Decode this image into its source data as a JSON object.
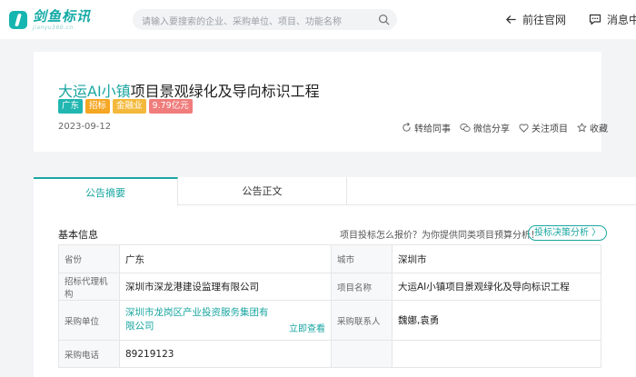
{
  "header": {
    "logo_cn": "剑鱼标讯",
    "logo_en": "jianyu360.cn",
    "search_placeholder": "请输入要搜索的企业、采购单位、项目、功能名称",
    "home_link": "前往官网",
    "msg_link": "消息中"
  },
  "project": {
    "title_highlight": "大运AI小镇",
    "title_rest": "项目景观绿化及导向标识工程",
    "tags": [
      "广东",
      "招标",
      "金融业",
      "9.79亿元"
    ],
    "date": "2023-09-12",
    "actions": [
      "转给同事",
      "微信分享",
      "关注项目",
      "收藏"
    ]
  },
  "tabs": [
    "公告摘要",
    "公告正文"
  ],
  "basic": {
    "title": "基本信息",
    "hint": "项目投标怎么报价？为你提供同类项目预算分析！",
    "btn": "投标决策分析 〉"
  },
  "rows": {
    "province_k": "省份",
    "province_v": "广东",
    "city_k": "城市",
    "city_v": "深圳市",
    "agent_k": "招标代理机构",
    "agent_v": "深圳市深龙港建设监理有限公司",
    "proj_k": "项目名称",
    "proj_v": "大运AI小镇项目景观绿化及导向标识工程",
    "buyer_k": "采购单位",
    "buyer_v": "深圳市龙岗区产业投资服务集团有限公司",
    "view_now": "立即查看",
    "contact_k": "采购联系人",
    "contact_v": "魏娜,袁勇",
    "phone_k": "采购电话",
    "phone_v": "89219123"
  },
  "colors": {
    "accent": "#1aa6a1",
    "tag_region": "#22b6b1",
    "tag_type": "#f5a623",
    "tag_industry": "#f4b93c",
    "tag_amount": "#f07c7c"
  }
}
